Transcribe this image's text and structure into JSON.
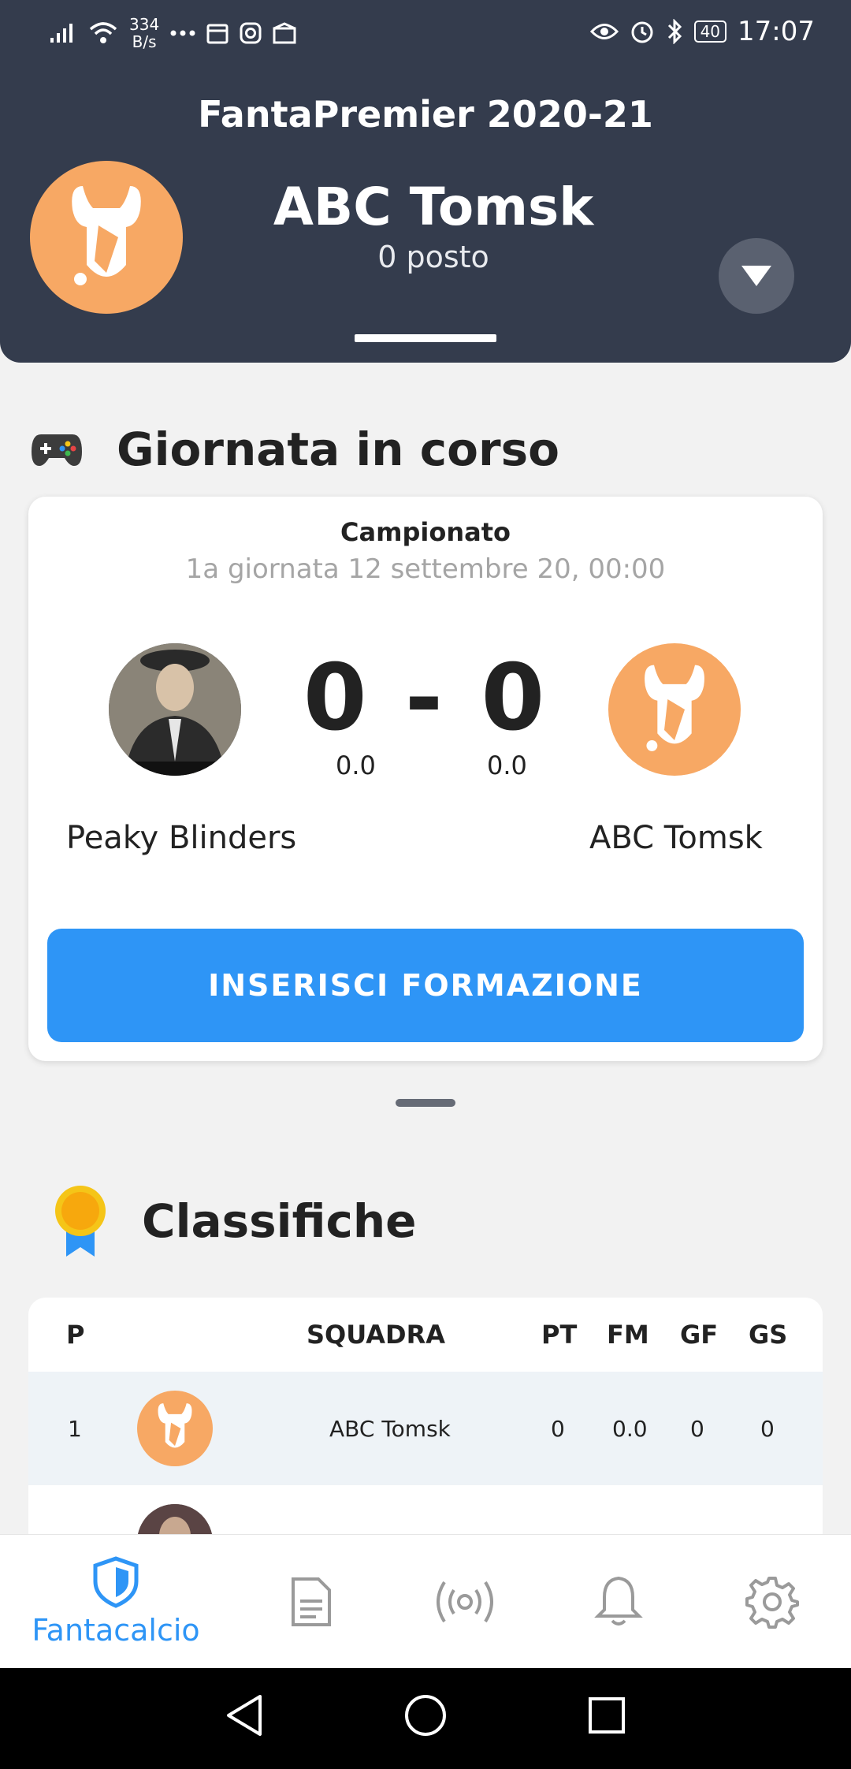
{
  "status_bar": {
    "speed": "334",
    "speed_unit": "B/s",
    "battery": "40",
    "time": "17:07"
  },
  "header": {
    "league": "FantaPremier 2020-21",
    "team_name": "ABC Tomsk",
    "rank": "0 posto"
  },
  "current_round": {
    "section_title": "Giornata in corso",
    "competition": "Campionato",
    "round_info": "1a giornata 12 settembre 20, 00:00",
    "score": "0 - 0",
    "home_points": "0.0",
    "away_points": "0.0",
    "home_team": "Peaky Blinders",
    "away_team": "ABC Tomsk",
    "cta_label": "INSERISCI FORMAZIONE"
  },
  "standings": {
    "section_title": "Classifiche",
    "columns": [
      "P",
      "SQUADRA",
      "PT",
      "FM",
      "GF",
      "GS"
    ],
    "rows": [
      {
        "pos": "1",
        "team": "ABC Tomsk",
        "pt": "0",
        "fm": "0.0",
        "gf": "0",
        "gs": "0"
      }
    ]
  },
  "bottom_nav": {
    "active_label": "Fantacalcio",
    "items": [
      "shield-icon",
      "document-icon",
      "broadcast-icon",
      "bell-icon",
      "gear-icon"
    ]
  },
  "colors": {
    "header_bg": "#343c4d",
    "accent": "#2e95f6",
    "logo_orange": "#f7a864"
  }
}
